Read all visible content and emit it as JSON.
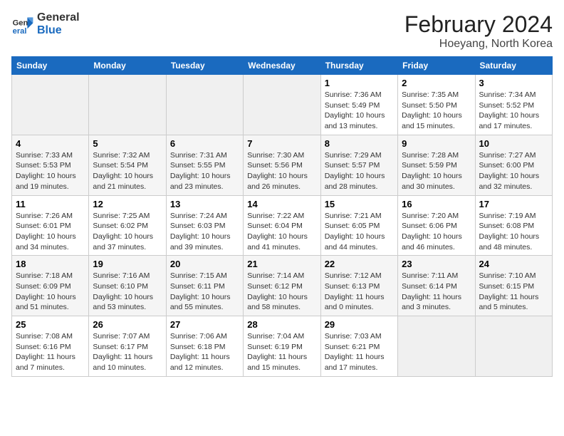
{
  "header": {
    "logo_general": "General",
    "logo_blue": "Blue",
    "title": "February 2024",
    "subtitle": "Hoeyang, North Korea"
  },
  "days_of_week": [
    "Sunday",
    "Monday",
    "Tuesday",
    "Wednesday",
    "Thursday",
    "Friday",
    "Saturday"
  ],
  "weeks": [
    [
      {
        "num": "",
        "info": ""
      },
      {
        "num": "",
        "info": ""
      },
      {
        "num": "",
        "info": ""
      },
      {
        "num": "",
        "info": ""
      },
      {
        "num": "1",
        "info": "Sunrise: 7:36 AM\nSunset: 5:49 PM\nDaylight: 10 hours\nand 13 minutes."
      },
      {
        "num": "2",
        "info": "Sunrise: 7:35 AM\nSunset: 5:50 PM\nDaylight: 10 hours\nand 15 minutes."
      },
      {
        "num": "3",
        "info": "Sunrise: 7:34 AM\nSunset: 5:52 PM\nDaylight: 10 hours\nand 17 minutes."
      }
    ],
    [
      {
        "num": "4",
        "info": "Sunrise: 7:33 AM\nSunset: 5:53 PM\nDaylight: 10 hours\nand 19 minutes."
      },
      {
        "num": "5",
        "info": "Sunrise: 7:32 AM\nSunset: 5:54 PM\nDaylight: 10 hours\nand 21 minutes."
      },
      {
        "num": "6",
        "info": "Sunrise: 7:31 AM\nSunset: 5:55 PM\nDaylight: 10 hours\nand 23 minutes."
      },
      {
        "num": "7",
        "info": "Sunrise: 7:30 AM\nSunset: 5:56 PM\nDaylight: 10 hours\nand 26 minutes."
      },
      {
        "num": "8",
        "info": "Sunrise: 7:29 AM\nSunset: 5:57 PM\nDaylight: 10 hours\nand 28 minutes."
      },
      {
        "num": "9",
        "info": "Sunrise: 7:28 AM\nSunset: 5:59 PM\nDaylight: 10 hours\nand 30 minutes."
      },
      {
        "num": "10",
        "info": "Sunrise: 7:27 AM\nSunset: 6:00 PM\nDaylight: 10 hours\nand 32 minutes."
      }
    ],
    [
      {
        "num": "11",
        "info": "Sunrise: 7:26 AM\nSunset: 6:01 PM\nDaylight: 10 hours\nand 34 minutes."
      },
      {
        "num": "12",
        "info": "Sunrise: 7:25 AM\nSunset: 6:02 PM\nDaylight: 10 hours\nand 37 minutes."
      },
      {
        "num": "13",
        "info": "Sunrise: 7:24 AM\nSunset: 6:03 PM\nDaylight: 10 hours\nand 39 minutes."
      },
      {
        "num": "14",
        "info": "Sunrise: 7:22 AM\nSunset: 6:04 PM\nDaylight: 10 hours\nand 41 minutes."
      },
      {
        "num": "15",
        "info": "Sunrise: 7:21 AM\nSunset: 6:05 PM\nDaylight: 10 hours\nand 44 minutes."
      },
      {
        "num": "16",
        "info": "Sunrise: 7:20 AM\nSunset: 6:06 PM\nDaylight: 10 hours\nand 46 minutes."
      },
      {
        "num": "17",
        "info": "Sunrise: 7:19 AM\nSunset: 6:08 PM\nDaylight: 10 hours\nand 48 minutes."
      }
    ],
    [
      {
        "num": "18",
        "info": "Sunrise: 7:18 AM\nSunset: 6:09 PM\nDaylight: 10 hours\nand 51 minutes."
      },
      {
        "num": "19",
        "info": "Sunrise: 7:16 AM\nSunset: 6:10 PM\nDaylight: 10 hours\nand 53 minutes."
      },
      {
        "num": "20",
        "info": "Sunrise: 7:15 AM\nSunset: 6:11 PM\nDaylight: 10 hours\nand 55 minutes."
      },
      {
        "num": "21",
        "info": "Sunrise: 7:14 AM\nSunset: 6:12 PM\nDaylight: 10 hours\nand 58 minutes."
      },
      {
        "num": "22",
        "info": "Sunrise: 7:12 AM\nSunset: 6:13 PM\nDaylight: 11 hours\nand 0 minutes."
      },
      {
        "num": "23",
        "info": "Sunrise: 7:11 AM\nSunset: 6:14 PM\nDaylight: 11 hours\nand 3 minutes."
      },
      {
        "num": "24",
        "info": "Sunrise: 7:10 AM\nSunset: 6:15 PM\nDaylight: 11 hours\nand 5 minutes."
      }
    ],
    [
      {
        "num": "25",
        "info": "Sunrise: 7:08 AM\nSunset: 6:16 PM\nDaylight: 11 hours\nand 7 minutes."
      },
      {
        "num": "26",
        "info": "Sunrise: 7:07 AM\nSunset: 6:17 PM\nDaylight: 11 hours\nand 10 minutes."
      },
      {
        "num": "27",
        "info": "Sunrise: 7:06 AM\nSunset: 6:18 PM\nDaylight: 11 hours\nand 12 minutes."
      },
      {
        "num": "28",
        "info": "Sunrise: 7:04 AM\nSunset: 6:19 PM\nDaylight: 11 hours\nand 15 minutes."
      },
      {
        "num": "29",
        "info": "Sunrise: 7:03 AM\nSunset: 6:21 PM\nDaylight: 11 hours\nand 17 minutes."
      },
      {
        "num": "",
        "info": ""
      },
      {
        "num": "",
        "info": ""
      }
    ]
  ]
}
